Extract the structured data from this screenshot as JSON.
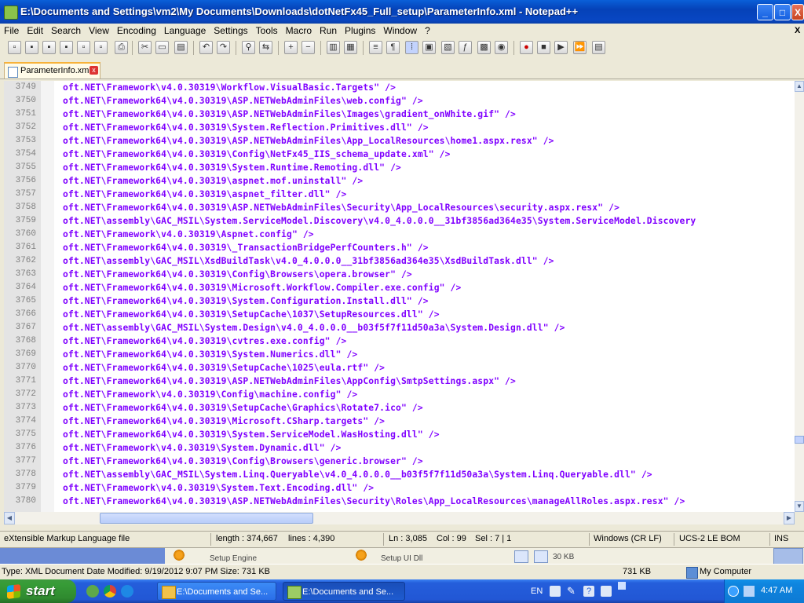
{
  "window": {
    "title": "E:\\Documents and Settings\\vm2\\My Documents\\Downloads\\dotNetFx45_Full_setup\\ParameterInfo.xml - Notepad++",
    "minimize": "_",
    "maximize": "□",
    "close": "X"
  },
  "menu": [
    "File",
    "Edit",
    "Search",
    "View",
    "Encoding",
    "Language",
    "Settings",
    "Tools",
    "Macro",
    "Run",
    "Plugins",
    "Window",
    "?"
  ],
  "menu_close": "X",
  "tab": {
    "label": "ParameterInfo.xml",
    "close": "x"
  },
  "lines": [
    {
      "n": "3749",
      "t": "oft.NET\\Framework\\v4.0.30319\\Workflow.VisualBasic.Targets\" />"
    },
    {
      "n": "3750",
      "t": "oft.NET\\Framework64\\v4.0.30319\\ASP.NETWebAdminFiles\\web.config\" />"
    },
    {
      "n": "3751",
      "t": "oft.NET\\Framework64\\v4.0.30319\\ASP.NETWebAdminFiles\\Images\\gradient_onWhite.gif\" />"
    },
    {
      "n": "3752",
      "t": "oft.NET\\Framework64\\v4.0.30319\\System.Reflection.Primitives.dll\" />"
    },
    {
      "n": "3753",
      "t": "oft.NET\\Framework64\\v4.0.30319\\ASP.NETWebAdminFiles\\App_LocalResources\\home1.aspx.resx\" />"
    },
    {
      "n": "3754",
      "t": "oft.NET\\Framework64\\v4.0.30319\\Config\\NetFx45_IIS_schema_update.xml\" />"
    },
    {
      "n": "3755",
      "t": "oft.NET\\Framework64\\v4.0.30319\\System.Runtime.Remoting.dll\" />"
    },
    {
      "n": "3756",
      "t": "oft.NET\\Framework64\\v4.0.30319\\aspnet.mof.uninstall\" />"
    },
    {
      "n": "3757",
      "t": "oft.NET\\Framework64\\v4.0.30319\\aspnet_filter.dll\" />"
    },
    {
      "n": "3758",
      "t": "oft.NET\\Framework64\\v4.0.30319\\ASP.NETWebAdminFiles\\Security\\App_LocalResources\\security.aspx.resx\" />"
    },
    {
      "n": "3759",
      "t": "oft.NET\\assembly\\GAC_MSIL\\System.ServiceModel.Discovery\\v4.0_4.0.0.0__31bf3856ad364e35\\System.ServiceModel.Discovery"
    },
    {
      "n": "3760",
      "t": "oft.NET\\Framework\\v4.0.30319\\Aspnet.config\" />"
    },
    {
      "n": "3761",
      "t": "oft.NET\\Framework64\\v4.0.30319\\_TransactionBridgePerfCounters.h\" />"
    },
    {
      "n": "3762",
      "t": "oft.NET\\assembly\\GAC_MSIL\\XsdBuildTask\\v4.0_4.0.0.0__31bf3856ad364e35\\XsdBuildTask.dll\" />"
    },
    {
      "n": "3763",
      "t": "oft.NET\\Framework64\\v4.0.30319\\Config\\Browsers\\opera.browser\" />"
    },
    {
      "n": "3764",
      "t": "oft.NET\\Framework64\\v4.0.30319\\Microsoft.Workflow.Compiler.exe.config\" />"
    },
    {
      "n": "3765",
      "t": "oft.NET\\Framework64\\v4.0.30319\\System.Configuration.Install.dll\" />"
    },
    {
      "n": "3766",
      "t": "oft.NET\\Framework64\\v4.0.30319\\SetupCache\\1037\\SetupResources.dll\" />"
    },
    {
      "n": "3767",
      "t": "oft.NET\\assembly\\GAC_MSIL\\System.Design\\v4.0_4.0.0.0__b03f5f7f11d50a3a\\System.Design.dll\" />"
    },
    {
      "n": "3768",
      "t": "oft.NET\\Framework64\\v4.0.30319\\cvtres.exe.config\" />"
    },
    {
      "n": "3769",
      "t": "oft.NET\\Framework64\\v4.0.30319\\System.Numerics.dll\" />"
    },
    {
      "n": "3770",
      "t": "oft.NET\\Framework64\\v4.0.30319\\SetupCache\\1025\\eula.rtf\" />"
    },
    {
      "n": "3771",
      "t": "oft.NET\\Framework64\\v4.0.30319\\ASP.NETWebAdminFiles\\AppConfig\\SmtpSettings.aspx\" />"
    },
    {
      "n": "3772",
      "t": "oft.NET\\Framework\\v4.0.30319\\Config\\machine.config\" />"
    },
    {
      "n": "3773",
      "t": "oft.NET\\Framework64\\v4.0.30319\\SetupCache\\Graphics\\Rotate7.ico\" />"
    },
    {
      "n": "3774",
      "t": "oft.NET\\Framework64\\v4.0.30319\\Microsoft.CSharp.targets\" />"
    },
    {
      "n": "3775",
      "t": "oft.NET\\Framework64\\v4.0.30319\\System.ServiceModel.WasHosting.dll\" />"
    },
    {
      "n": "3776",
      "t": "oft.NET\\Framework\\v4.0.30319\\System.Dynamic.dll\" />"
    },
    {
      "n": "3777",
      "t": "oft.NET\\Framework64\\v4.0.30319\\Config\\Browsers\\generic.browser\" />"
    },
    {
      "n": "3778",
      "t": "oft.NET\\assembly\\GAC_MSIL\\System.Linq.Queryable\\v4.0_4.0.0.0__b03f5f7f11d50a3a\\System.Linq.Queryable.dll\" />"
    },
    {
      "n": "3779",
      "t": "oft.NET\\Framework\\v4.0.30319\\System.Text.Encoding.dll\" />"
    },
    {
      "n": "3780",
      "t": "oft.NET\\Framework64\\v4.0.30319\\ASP.NETWebAdminFiles\\Security\\Roles\\App_LocalResources\\manageAllRoles.aspx.resx\" />"
    }
  ],
  "status": {
    "filetype": "eXtensible Markup Language file",
    "length": "length : 374,667",
    "lines": "lines : 4,390",
    "ln": "Ln : 3,085",
    "col": "Col : 99",
    "sel": "Sel : 7 | 1",
    "eol": "Windows (CR LF)",
    "encoding": "UCS-2 LE BOM",
    "mode": "INS"
  },
  "background_window": {
    "item1": "Setup Engine",
    "item2": "Setup UI Dll",
    "size": "30 KB"
  },
  "explorer_status": {
    "info": "Type: XML Document Date Modified: 9/19/2012 9:07 PM Size: 731 KB",
    "size": "731 KB",
    "zone": "My Computer"
  },
  "taskbar": {
    "start": "start",
    "tasks": [
      "E:\\Documents and Se...",
      "E:\\Documents and Se..."
    ],
    "lang": "EN",
    "clock": "4:47 AM"
  },
  "colors": {
    "code_text": "#8000ff",
    "title_bar": "#0542b8",
    "taskbar": "#245edb",
    "start": "#379c37"
  },
  "icons": [
    "notepadpp-icon",
    "xml-file-icon",
    "folder-icon",
    "firefox-icon",
    "chrome-icon",
    "ie-icon",
    "network-icon",
    "speaker-icon",
    "help-icon"
  ]
}
